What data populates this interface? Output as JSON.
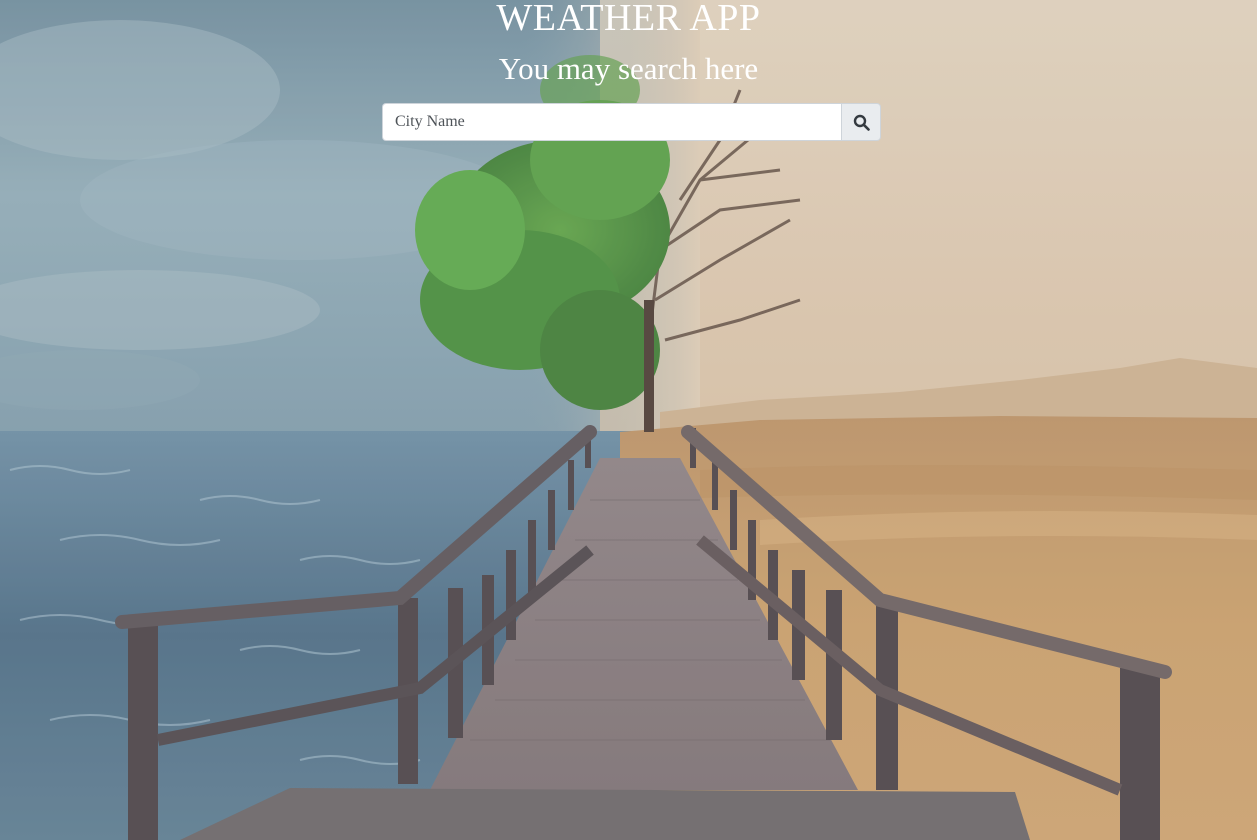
{
  "header": {
    "title": "WEATHER APP",
    "subtitle": "You may search here"
  },
  "search": {
    "placeholder": "City Name",
    "value": "",
    "button_icon": "search-icon"
  },
  "background": {
    "description_colors": {
      "sky_left": "#6f8fa0",
      "sky_right": "#d9c6ad",
      "sea": "#4d6c84",
      "desert": "#c49a62"
    }
  }
}
